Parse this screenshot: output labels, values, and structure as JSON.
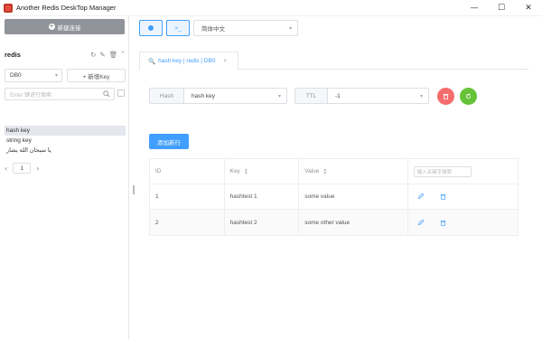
{
  "window": {
    "title": "Another Redis DeskTop Manager",
    "controls": [
      "—",
      "☐",
      "✕"
    ]
  },
  "sidebar": {
    "new_connection_label": "新建连接",
    "connection_name": "redis",
    "db_select": "DB0",
    "new_key_label": "+ 新增Key",
    "search_placeholder": "Enter 键进行搜索",
    "keys": [
      {
        "label": "hash key",
        "active": true
      },
      {
        "label": "string key",
        "active": false
      },
      {
        "label": "يا سبحان الله بشار",
        "active": false
      }
    ],
    "page_number": "1"
  },
  "topbar": {
    "terminal_label": ">_",
    "language": "简体中文"
  },
  "tab": {
    "label": "hash key | redis | DB0",
    "close": "×"
  },
  "key_panel": {
    "type_label": "Hash",
    "key_name": "hash key",
    "ttl_label": "TTL",
    "ttl_value": "-1",
    "delete_color": "#f56c6c",
    "refresh_color": "#67c23a"
  },
  "add_row_label": "添加新行",
  "table": {
    "headers": {
      "id": "ID",
      "key": "Key",
      "value": "Value"
    },
    "search_placeholder": "输入关键字搜索",
    "rows": [
      {
        "id": "1",
        "key": "hashtest 1",
        "value": "some value"
      },
      {
        "id": "2",
        "key": "hashtest 2",
        "value": "some other value"
      }
    ]
  },
  "colors": {
    "accent": "#409eff",
    "sidebar_button": "#909399"
  }
}
